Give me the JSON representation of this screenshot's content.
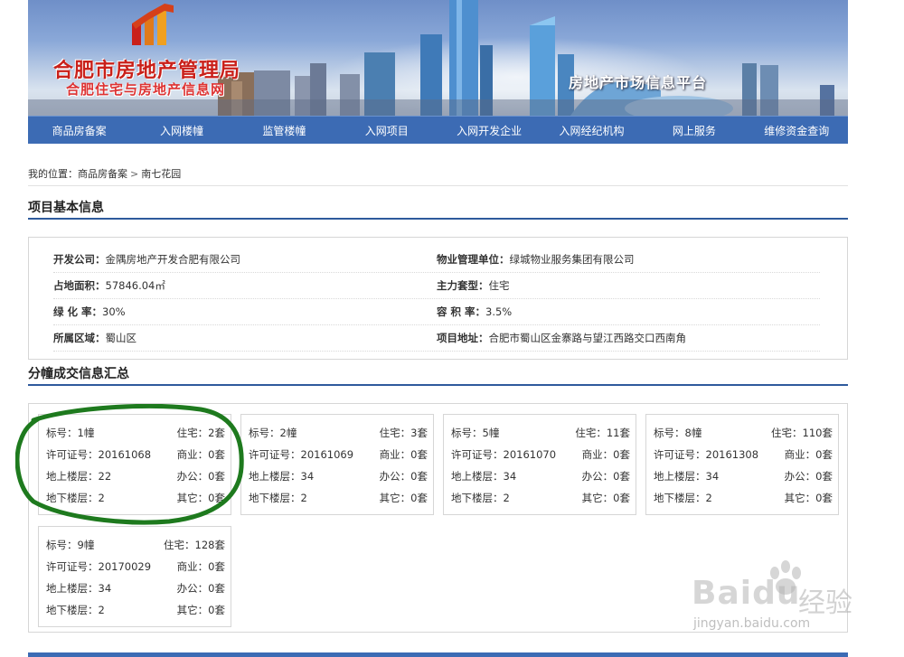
{
  "banner": {
    "org_title": "合肥市房地产管理局",
    "org_subtitle": "合肥住宅与房地产信息网",
    "platform_title": "房地产市场信息平台"
  },
  "nav": {
    "items": [
      "商品房备案",
      "入网楼幢",
      "监管楼幢",
      "入网项目",
      "入网开发企业",
      "入网经纪机构",
      "网上服务",
      "维修资金查询"
    ]
  },
  "breadcrumb": {
    "prefix": "我的位置：",
    "items": [
      "商品房备案",
      "南七花园"
    ],
    "separator": ">"
  },
  "project": {
    "section_title": "项目基本信息",
    "rows": [
      [
        {
          "label": "开发公司：",
          "value": "金隅房地产开发合肥有限公司"
        },
        {
          "label": "物业管理单位：",
          "value": "绿城物业服务集团有限公司"
        }
      ],
      [
        {
          "label": "占地面积：",
          "value": "57846.04㎡"
        },
        {
          "label": "主力套型：",
          "value": "住宅"
        }
      ],
      [
        {
          "label": "绿 化 率：",
          "value": "30%"
        },
        {
          "label": "容 积 率：",
          "value": "3.5%"
        }
      ],
      [
        {
          "label": "所属区域：",
          "value": "蜀山区"
        },
        {
          "label": "项目地址：",
          "value": "合肥市蜀山区金寨路与望江西路交口西南角"
        }
      ]
    ]
  },
  "buildings": {
    "section_title": "分幢成交信息汇总",
    "cards": [
      {
        "rows": [
          [
            "标号：1幢",
            "住宅：2套"
          ],
          [
            "许可证号：20161068",
            "商业：0套"
          ],
          [
            "地上楼层：22",
            "办公：0套"
          ],
          [
            "地下楼层：2",
            "其它：0套"
          ]
        ]
      },
      {
        "rows": [
          [
            "标号：2幢",
            "住宅：3套"
          ],
          [
            "许可证号：20161069",
            "商业：0套"
          ],
          [
            "地上楼层：34",
            "办公：0套"
          ],
          [
            "地下楼层：2",
            "其它：0套"
          ]
        ]
      },
      {
        "rows": [
          [
            "标号：5幢",
            "住宅：11套"
          ],
          [
            "许可证号：20161070",
            "商业：0套"
          ],
          [
            "地上楼层：34",
            "办公：0套"
          ],
          [
            "地下楼层：2",
            "其它：0套"
          ]
        ]
      },
      {
        "rows": [
          [
            "标号：8幢",
            "住宅：110套"
          ],
          [
            "许可证号：20161308",
            "商业：0套"
          ],
          [
            "地上楼层：34",
            "办公：0套"
          ],
          [
            "地下楼层：2",
            "其它：0套"
          ]
        ]
      },
      {
        "rows": [
          [
            "标号：9幢",
            "住宅：128套"
          ],
          [
            "许可证号：20170029",
            "商业：0套"
          ],
          [
            "地上楼层：34",
            "办公：0套"
          ],
          [
            "地下楼层：2",
            "其它：0套"
          ]
        ]
      }
    ]
  },
  "watermark": {
    "brand": "Baidu",
    "brand_cn": "经验",
    "url": "jingyan.baidu.com"
  },
  "colors": {
    "nav_bg": "#3c6bb4",
    "rule_blue": "#2e5a9c",
    "title_red": "#c9201a",
    "annotation_green": "#1e7a1e"
  }
}
